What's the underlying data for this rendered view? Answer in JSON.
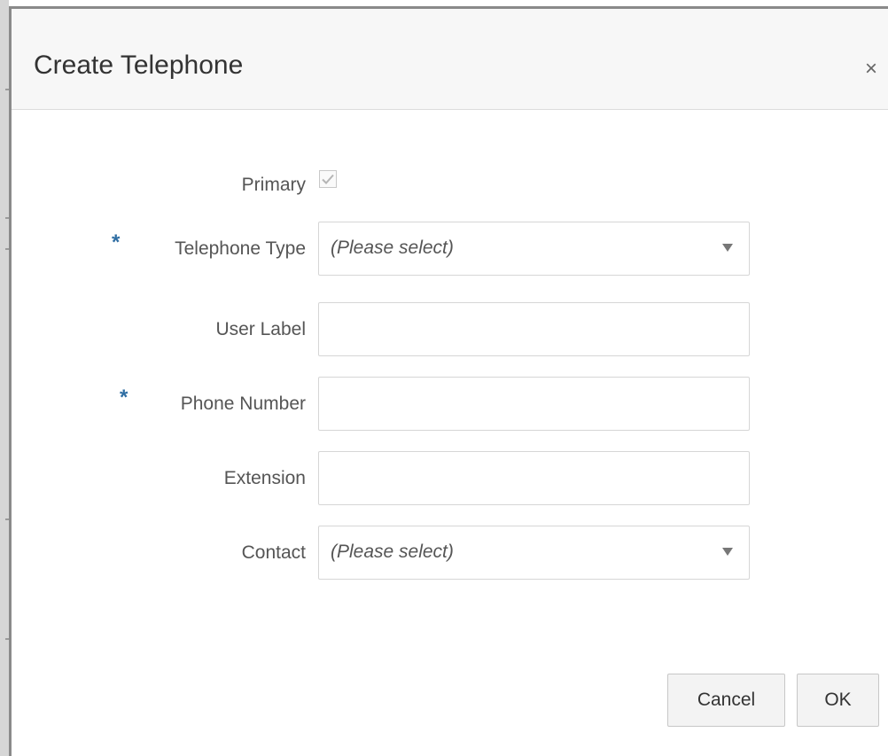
{
  "dialog": {
    "title": "Create Telephone",
    "close_symbol": "×"
  },
  "form": {
    "primary": {
      "label": "Primary",
      "checked": true
    },
    "telephone_type": {
      "label": "Telephone Type",
      "required": true,
      "value": "(Please select)"
    },
    "user_label": {
      "label": "User Label",
      "value": ""
    },
    "phone_number": {
      "label": "Phone Number",
      "required": true,
      "value": ""
    },
    "extension": {
      "label": "Extension",
      "value": ""
    },
    "contact": {
      "label": "Contact",
      "value": "(Please select)"
    },
    "required_marker": "*"
  },
  "buttons": {
    "cancel": "Cancel",
    "ok": "OK"
  },
  "icons": {
    "close": "close-icon",
    "dropdown": "chevron-down-icon",
    "check": "checkmark-icon"
  },
  "colors": {
    "required_star": "#2f6ea3",
    "header_bg": "#f7f7f7",
    "border": "#d6d6d6"
  }
}
